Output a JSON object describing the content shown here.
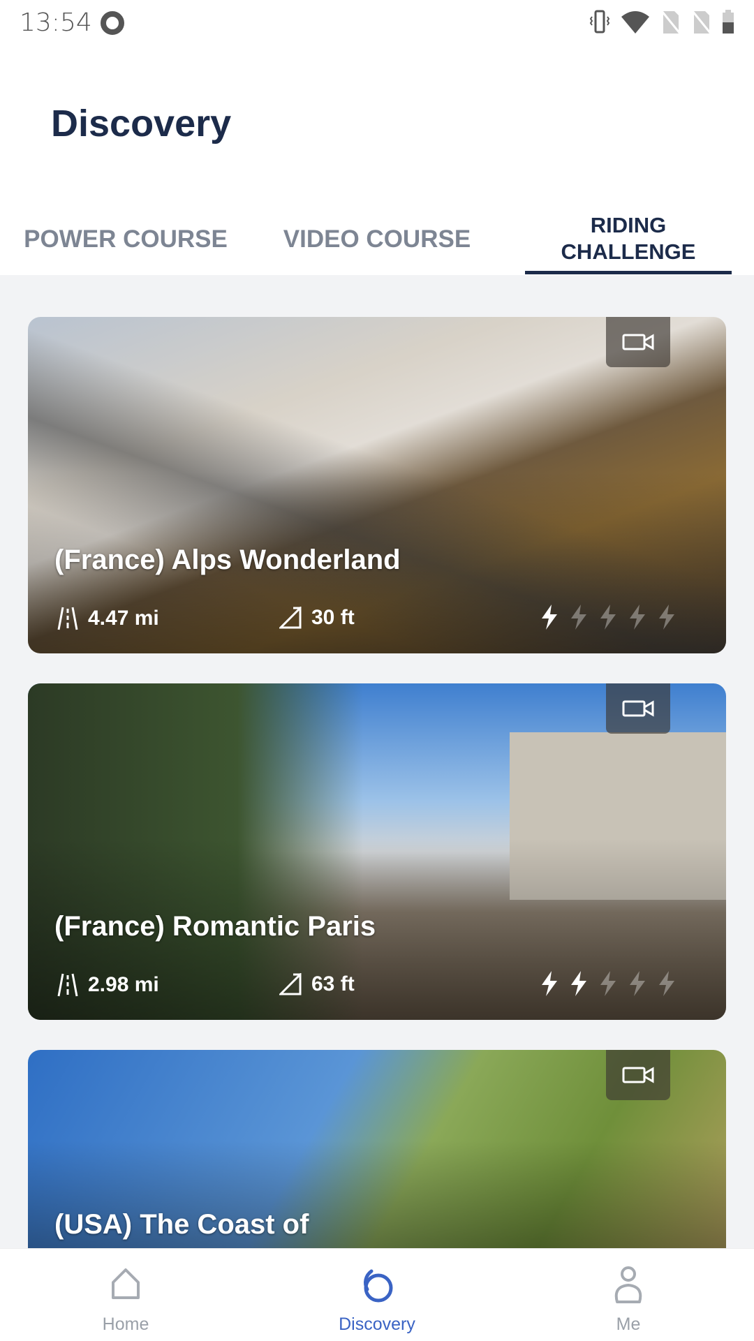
{
  "status_bar": {
    "time": "13:54",
    "icons": [
      "q-app-icon",
      "vibrate-icon",
      "wifi-icon",
      "no-sim-icon",
      "no-sim-icon",
      "battery-icon"
    ]
  },
  "header": {
    "title": "Discovery"
  },
  "tabs": [
    {
      "label": "POWER COURSE",
      "active": false
    },
    {
      "label": "VIDEO COURSE",
      "active": false
    },
    {
      "label": "RIDING CHALLENGE",
      "active": true
    }
  ],
  "cards": [
    {
      "title": "(France) Alps Wonderland",
      "distance": "4.47 mi",
      "elevation": "30 ft",
      "difficulty": 1,
      "difficulty_max": 5,
      "badge_icon": "video-camera-icon"
    },
    {
      "title": "(France) Romantic Paris",
      "distance": "2.98 mi",
      "elevation": "63 ft",
      "difficulty": 2,
      "difficulty_max": 5,
      "badge_icon": "video-camera-icon"
    },
    {
      "title": "(USA) The Coast of",
      "badge_icon": "video-camera-icon"
    }
  ],
  "bottom_nav": [
    {
      "label": "Home",
      "icon": "home-icon",
      "active": false
    },
    {
      "label": "Discovery",
      "icon": "discovery-icon",
      "active": true
    },
    {
      "label": "Me",
      "icon": "person-icon",
      "active": false
    }
  ],
  "colors": {
    "primary": "#1c2b4a",
    "accent": "#3a63c4",
    "inactive": "#7d8593",
    "background": "#f2f3f5"
  }
}
